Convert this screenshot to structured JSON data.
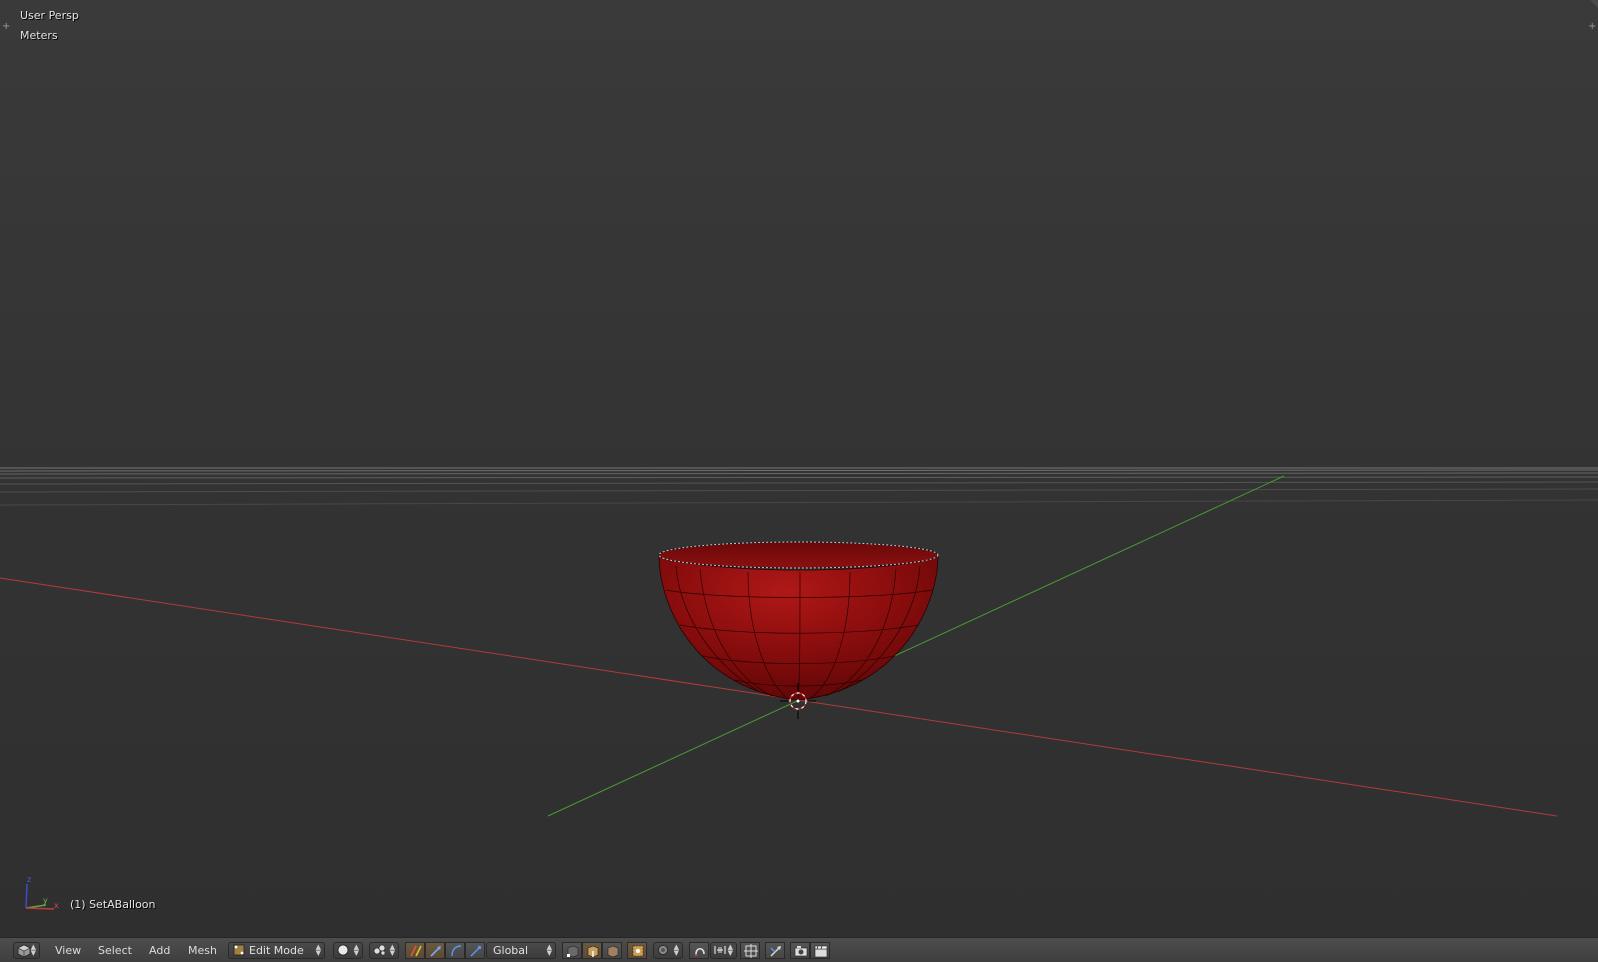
{
  "viewport": {
    "view_name": "User Persp",
    "units": "Meters",
    "object_info": "(1) SetABalloon",
    "colors": {
      "x_axis": "#b33a3a",
      "y_axis": "#4a9a32",
      "mesh": "#8a0d0d",
      "background": "#333333"
    }
  },
  "header": {
    "editor_icon": "cube-icon",
    "menus": {
      "view": "View",
      "select": "Select",
      "add": "Add",
      "mesh": "Mesh"
    },
    "mode": "Edit Mode",
    "transform_orientation": "Global",
    "icons": [
      "viewport-shading-icon",
      "pivot-point-icon",
      "manipulator-toggle-icon",
      "translate-icon",
      "rotate-icon",
      "scale-icon",
      "vertex-select-icon",
      "edge-select-icon",
      "face-select-icon",
      "limit-selection-icon",
      "proportional-edit-icon",
      "snap-toggle-icon",
      "snap-element-icon",
      "snap-target-icon",
      "render-preview-icon",
      "opengl-render-icon"
    ]
  }
}
